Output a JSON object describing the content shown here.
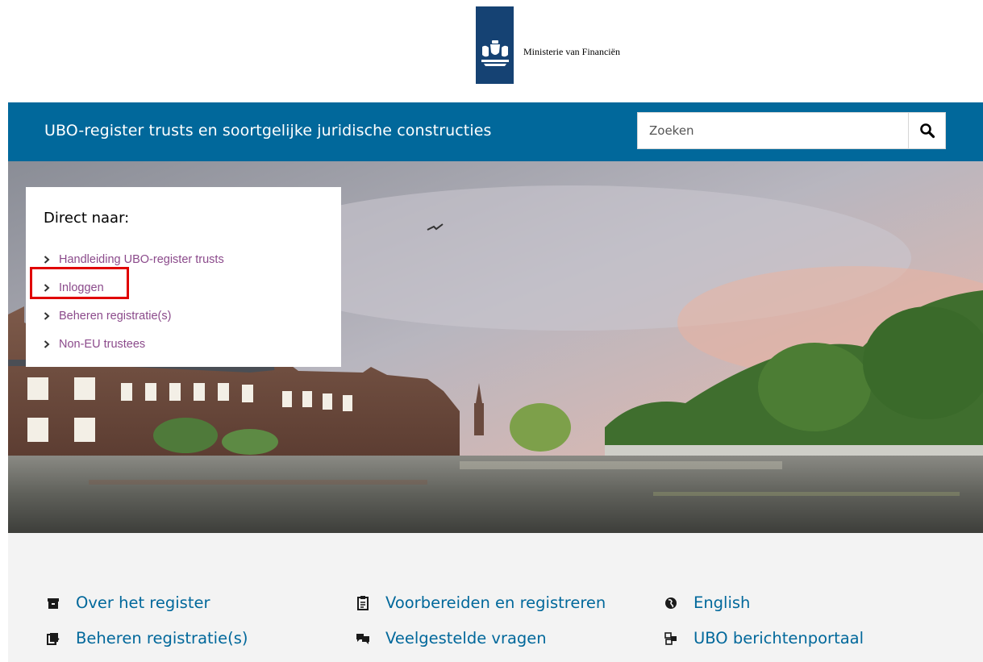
{
  "header": {
    "ministry": "Ministerie van Financiën",
    "site_title": "UBO-register trusts en soortgelijke juridische constructies",
    "search_placeholder": "Zoeken"
  },
  "direct": {
    "title": "Direct naar:",
    "items": [
      {
        "label": "Handleiding UBO-register trusts"
      },
      {
        "label": "Inloggen"
      },
      {
        "label": "Beheren registratie(s)"
      },
      {
        "label": "Non-EU trustees"
      }
    ]
  },
  "footer": {
    "links": [
      {
        "label": "Over het register",
        "icon": "archive-icon"
      },
      {
        "label": "Voorbereiden en registreren",
        "icon": "clipboard-icon"
      },
      {
        "label": "English",
        "icon": "globe-icon"
      },
      {
        "label": "Beheren registratie(s)",
        "icon": "edit-document-icon"
      },
      {
        "label": "Veelgestelde vragen",
        "icon": "chat-bubbles-icon"
      },
      {
        "label": "UBO berichtenportaal",
        "icon": "message-portal-icon"
      }
    ]
  },
  "colors": {
    "brand_blue": "#01689b",
    "logo_blue": "#154273",
    "link_purple": "#8b4a8b",
    "highlight_red": "#e00000"
  }
}
